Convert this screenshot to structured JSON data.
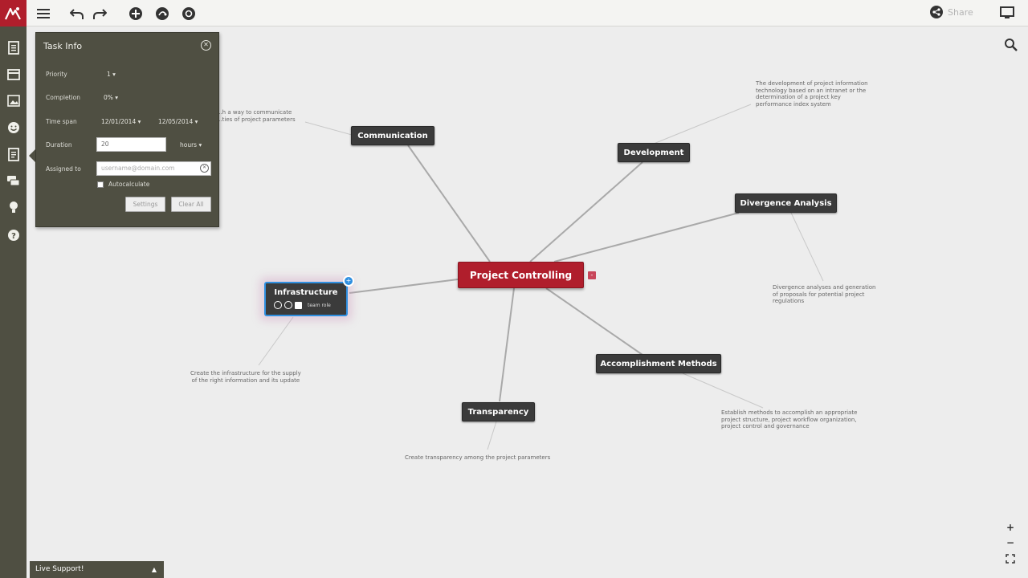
{
  "toolbar": {
    "share_label": "Share",
    "icons": [
      "logo-icon",
      "menu-icon",
      "undo-icon",
      "redo-icon",
      "add-icon",
      "share-node-icon",
      "style-icon"
    ]
  },
  "sidebar": {
    "items": [
      "document-icon",
      "card-icon",
      "image-icon",
      "smiley-icon",
      "task-icon",
      "comments-icon",
      "idea-icon",
      "help-icon"
    ]
  },
  "task_panel": {
    "title": "Task Info",
    "priority_label": "Priority",
    "priority_value": "1",
    "completion_label": "Completion",
    "completion_value": "0%",
    "timespan_label": "Time span",
    "start_date": "12/01/2014",
    "end_date": "12/05/2014",
    "duration_label": "Duration",
    "duration_value": "20",
    "duration_unit": "hours",
    "assigned_label": "Assigned to",
    "assigned_placeholder": "username@domain.com",
    "autocalc_label": "Autocalculate",
    "settings_label": "Settings",
    "clear_label": "Clear All"
  },
  "map": {
    "central": "Project Controlling",
    "collapse_mark": "-",
    "nodes": {
      "communication": "Communication",
      "development": "Development",
      "divergence": "Divergence Analysis",
      "accomplishment": "Accomplishment Methods",
      "transparency": "Transparency",
      "infrastructure": "Infrastructure"
    },
    "infra_tag": "team role",
    "infra_badge": "+",
    "notes": {
      "communication": "...h a way to communicate\n...ties of project parameters",
      "development": "The development of project information\ntechnology based on an intranet or the\ndetermination of a project key\nperformance index system",
      "divergence": "Divergence analyses and generation\nof proposals for potential project\nregulations",
      "accomplishment": "Establish methods to accomplish an appropriate\nproject structure, project workflow organization,\nproject control and governance",
      "transparency": "Create transparency among the project parameters",
      "infrastructure": "Create the infrastructure for the supply\nof the right information and its update"
    }
  },
  "footer": {
    "live_support": "Live Support!",
    "zoom_in": "+",
    "zoom_out": "−"
  }
}
